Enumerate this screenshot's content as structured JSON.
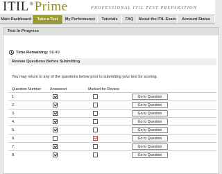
{
  "brand": {
    "logo_main": "ITIL",
    "logo_reg": "®",
    "logo_accent": "Prime",
    "tagline": "PROFESSIONAL ITIL TEST PREPARATION"
  },
  "nav": {
    "tabs": [
      {
        "label": "Main Dashboard",
        "active": false
      },
      {
        "label": "Take a Test",
        "active": true
      },
      {
        "label": "My Performance",
        "active": false
      },
      {
        "label": "Tutorials",
        "active": false
      },
      {
        "label": "FAQ",
        "active": false
      },
      {
        "label": "About the ITIL Exam",
        "active": false
      },
      {
        "label": "Account Status",
        "active": false
      }
    ]
  },
  "panel": {
    "title": "Test In Progress",
    "time_label": "Time Remaining:",
    "time_value": "56:49",
    "review_title": "Review Questions Before Submitting",
    "instructions": "You may return to any of the questions below prior to submitting your test for scoring."
  },
  "table": {
    "headers": {
      "number": "Question Number",
      "answered": "Answered",
      "marked": "Marked for Review"
    },
    "button_label": "Go to Question",
    "rows": [
      {
        "number": "1.",
        "answered": true,
        "marked": false
      },
      {
        "number": "2.",
        "answered": true,
        "marked": false
      },
      {
        "number": "3.",
        "answered": true,
        "marked": false
      },
      {
        "number": "4.",
        "answered": true,
        "marked": false
      },
      {
        "number": "5.",
        "answered": true,
        "marked": false
      },
      {
        "number": "6.",
        "answered": false,
        "marked": true
      },
      {
        "number": "7.",
        "answered": true,
        "marked": false
      },
      {
        "number": "8.",
        "answered": true,
        "marked": false
      }
    ]
  },
  "colors": {
    "accent": "#9c9a2a",
    "nav_bg": "#e3e3e3",
    "page_bg": "#e9e9e9"
  }
}
